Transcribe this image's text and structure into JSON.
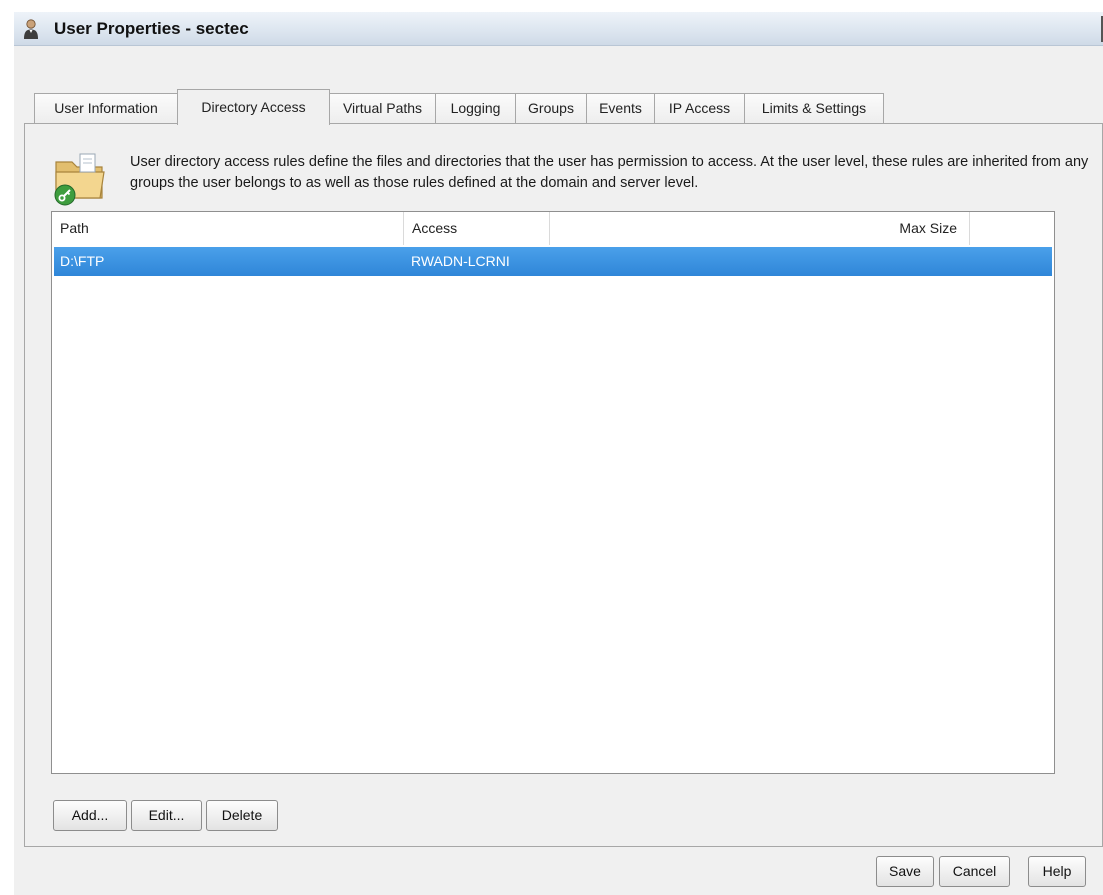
{
  "window": {
    "title": "User Properties - sectec"
  },
  "tabs": [
    {
      "label": "User Information",
      "active": false
    },
    {
      "label": "Directory Access",
      "active": true
    },
    {
      "label": "Virtual Paths",
      "active": false
    },
    {
      "label": "Logging",
      "active": false
    },
    {
      "label": "Groups",
      "active": false
    },
    {
      "label": "Events",
      "active": false
    },
    {
      "label": "IP Access",
      "active": false
    },
    {
      "label": "Limits & Settings",
      "active": false
    }
  ],
  "info": {
    "text": "User directory access rules define the files and directories that the user has permission to access. At the user level, these rules are inherited from any groups the user belongs to as well as those rules defined at the domain and server level.",
    "icon": "folder-key-icon"
  },
  "table": {
    "columns": [
      "Path",
      "Access",
      "Max Size"
    ],
    "rows": [
      {
        "path": "D:\\FTP",
        "access": "RWADN-LCRNI",
        "max_size": "",
        "selected": true
      }
    ]
  },
  "list_buttons": {
    "add": "Add...",
    "edit": "Edit...",
    "delete": "Delete"
  },
  "footer_buttons": {
    "save": "Save",
    "cancel": "Cancel",
    "help": "Help"
  },
  "colors": {
    "selection": "#3a92e0",
    "titlebar": "#dde6f0",
    "window_bg": "#f0f0f0"
  }
}
